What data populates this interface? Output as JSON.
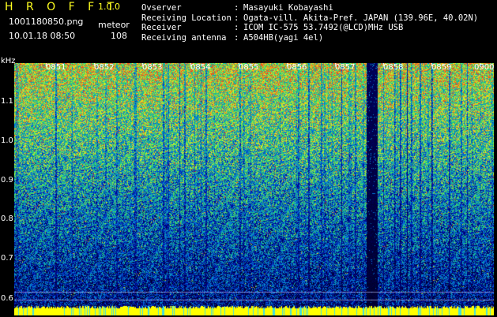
{
  "app": {
    "logo": "H R O F F T",
    "version": "1.0.0",
    "filename": "1001180850.png",
    "datetime": "10.01.18 08:50",
    "meteor_label": "meteor",
    "meteor_count": "108"
  },
  "info": [
    {
      "key": "Ovserver",
      "sep": ":",
      "value": "Masayuki Kobayashi"
    },
    {
      "key": "Receiving Location",
      "sep": ":",
      "value": "Ogata-vill. Akita-Pref. JAPAN (139.96E, 40.02N)"
    },
    {
      "key": "Receiver",
      "sep": ":",
      "value": "ICOM IC-575 53.7492(@LCD)MHz USB"
    },
    {
      "key": "Receiving antenna",
      "sep": ":",
      "value": "A504HB(yagi 4el)"
    }
  ],
  "axis": {
    "unit": "kHz",
    "y_ticks": [
      "1.1",
      "1.0",
      "0.9",
      "0.8",
      "0.7",
      "0.6"
    ],
    "time_labels": [
      "0851",
      "0852",
      "0853",
      "0854",
      "0855",
      "0856",
      "0857",
      "0858",
      "0859",
      "0900"
    ]
  },
  "colors": {
    "background": "#000000",
    "logo": "#ffff20",
    "text": "#ffffff",
    "noise_low": "#0a1a8c",
    "noise_mid": "#20a0e0",
    "noise_high": "#e0e040",
    "bottom_band": "#ffff00"
  }
}
